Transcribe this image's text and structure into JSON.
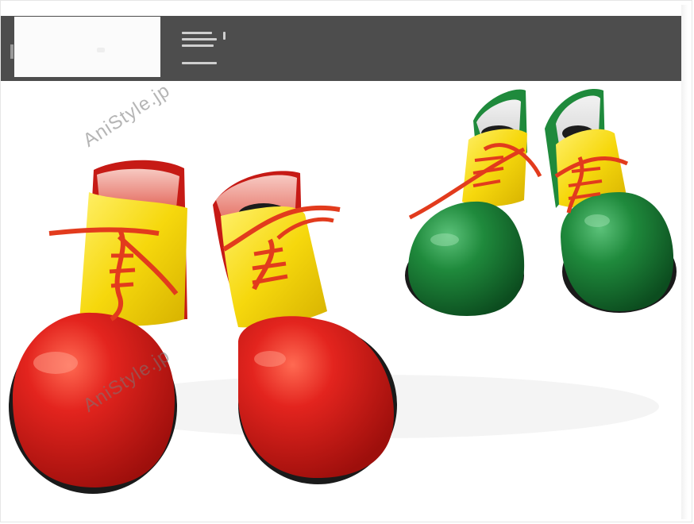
{
  "header": {
    "logo_box": "blank-logo-area",
    "menu_icon": "hamburger-menu-icon"
  },
  "photo": {
    "subject": "clown-shoes-photo",
    "watermarks": [
      "AniStyle.jp",
      "AniStyle.jp"
    ]
  },
  "colors": {
    "bar": "#4d4d4d",
    "red_shoe": "#d8201c",
    "yellow_upper": "#f6d80d",
    "green_shoe": "#1f8a3c",
    "lace": "#e23b1d"
  }
}
